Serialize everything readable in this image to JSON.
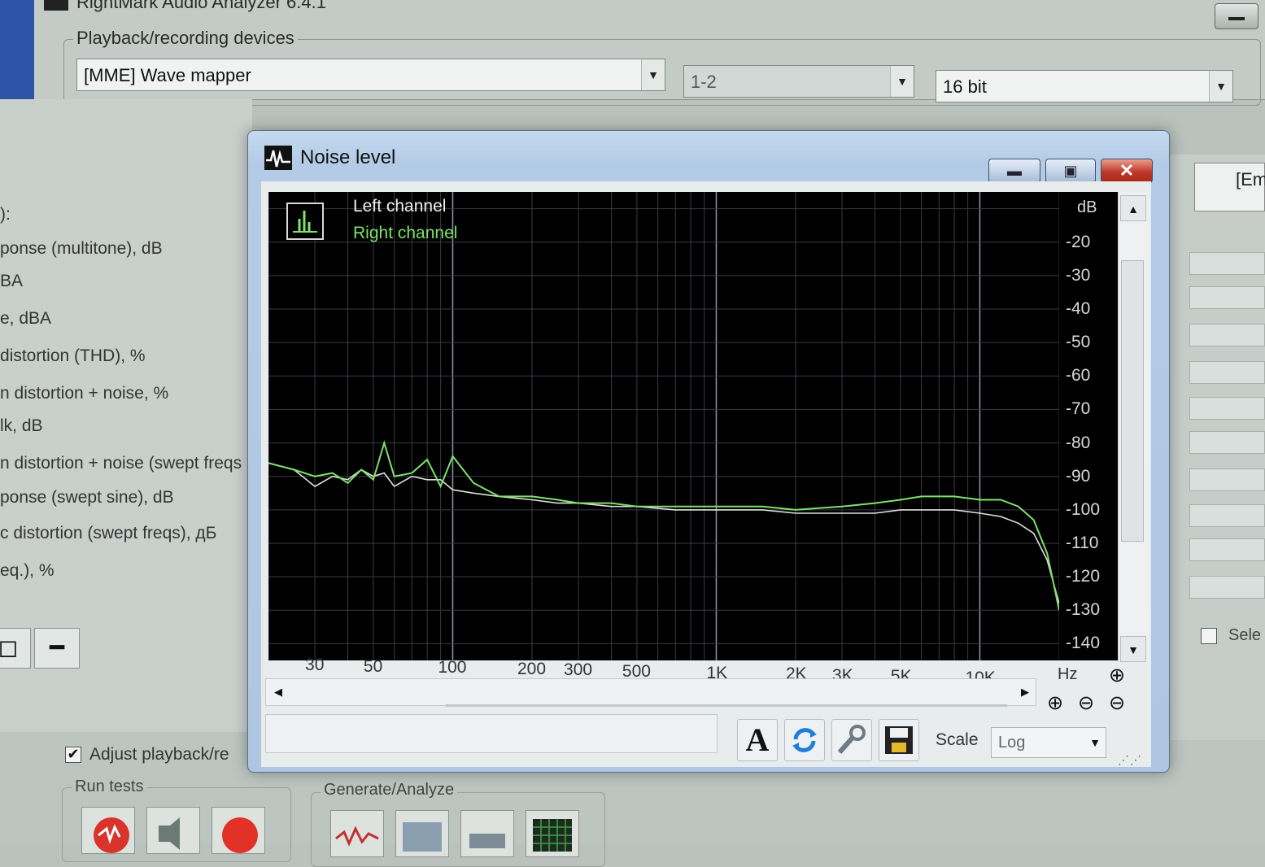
{
  "app": {
    "title": "RightMark Audio Analyzer 6.4.1",
    "devices_group_label": "Playback/recording devices",
    "device": "[MME] Wave mapper",
    "channels": "1-2",
    "bit_depth": "16 bit"
  },
  "params": [
    "):",
    "ponse (multitone), dB",
    "BA",
    "e, dBA",
    "distortion (THD), %",
    "n distortion + noise, %",
    "lk, dB",
    "n distortion + noise (swept freqs",
    "ponse (swept sine), dB",
    "c distortion (swept freqs), дБ",
    "eq.), %"
  ],
  "bottom": {
    "adjust_label": "Adjust playback/re",
    "run_tests_label": "Run tests",
    "generate_label": "Generate/Analyze"
  },
  "right": {
    "top_box": "[Em",
    "select_label": "Sele"
  },
  "window": {
    "title": "Noise level",
    "icon": "waveform-icon",
    "legend_left": "Left channel",
    "legend_right": "Right channel",
    "y_unit": "dB",
    "x_unit": "Hz",
    "scale_label": "Scale",
    "scale_value": "Log",
    "colors": {
      "left": "#e0e0e0",
      "right": "#7ee26b",
      "grid": "#3a3a46",
      "grid_major": "#8a8f9a"
    }
  },
  "chart_data": {
    "type": "line",
    "xscale": "log",
    "x_ticks": [
      "30",
      "50",
      "100",
      "200",
      "300",
      "500",
      "1K",
      "2K",
      "3K",
      "5K",
      "10K"
    ],
    "x_tick_values": [
      30,
      50,
      100,
      200,
      300,
      500,
      1000,
      2000,
      3000,
      5000,
      10000
    ],
    "y_ticks": [
      "-20",
      "-30",
      "-40",
      "-50",
      "-60",
      "-70",
      "-80",
      "-90",
      "-100",
      "-110",
      "-120",
      "-130",
      "-140"
    ],
    "y_tick_values": [
      -20,
      -30,
      -40,
      -50,
      -60,
      -70,
      -80,
      -90,
      -100,
      -110,
      -120,
      -130,
      -140
    ],
    "xlim": [
      20,
      20000
    ],
    "ylim": [
      -145,
      -5
    ],
    "ylabel": "dB",
    "xlabel": "Hz",
    "series": [
      {
        "name": "Left channel",
        "x": [
          20,
          25,
          30,
          35,
          40,
          45,
          50,
          55,
          60,
          70,
          80,
          90,
          100,
          120,
          150,
          200,
          250,
          300,
          400,
          500,
          700,
          1000,
          1500,
          2000,
          3000,
          4000,
          5000,
          6000,
          7000,
          8000,
          10000,
          12000,
          14000,
          16000,
          18000,
          20000
        ],
        "y": [
          -86,
          -88,
          -93,
          -90,
          -91,
          -88,
          -90,
          -89,
          -93,
          -90,
          -91,
          -91,
          -94,
          -95,
          -96,
          -97,
          -98,
          -98,
          -99,
          -99,
          -100,
          -100,
          -100,
          -101,
          -101,
          -101,
          -100,
          -100,
          -100,
          -100,
          -101,
          -102,
          -104,
          -107,
          -115,
          -128
        ]
      },
      {
        "name": "Right channel",
        "x": [
          20,
          25,
          30,
          35,
          40,
          45,
          50,
          55,
          60,
          70,
          80,
          90,
          100,
          120,
          150,
          200,
          250,
          300,
          400,
          500,
          700,
          1000,
          1500,
          2000,
          3000,
          4000,
          5000,
          6000,
          7000,
          8000,
          10000,
          12000,
          14000,
          16000,
          18000,
          20000
        ],
        "y": [
          -86,
          -88,
          -90,
          -89,
          -92,
          -88,
          -91,
          -80,
          -90,
          -89,
          -85,
          -93,
          -84,
          -92,
          -96,
          -96,
          -97,
          -98,
          -98,
          -99,
          -99,
          -99,
          -99,
          -100,
          -99,
          -98,
          -97,
          -96,
          -96,
          -96,
          -97,
          -97,
          -99,
          -103,
          -113,
          -130
        ]
      }
    ]
  }
}
